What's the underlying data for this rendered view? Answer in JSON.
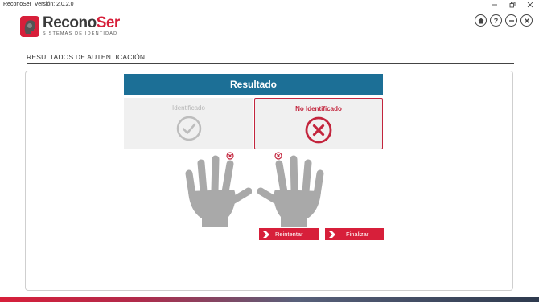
{
  "window": {
    "app_name": "ReconoSer",
    "version_label": "Versión: 2.0.2.0"
  },
  "brand": {
    "logo_main_1": "Recono",
    "logo_main_2": "Ser",
    "logo_sub": "SISTEMAS DE IDENTIDAD"
  },
  "header_icons": [
    {
      "name": "home-icon"
    },
    {
      "name": "help-icon",
      "glyph": "?"
    },
    {
      "name": "minimize-icon"
    },
    {
      "name": "close-icon"
    }
  ],
  "section": {
    "title": "RESULTADOS DE AUTENTICACIÓN"
  },
  "result": {
    "header": "Resultado",
    "identified_label": "Identificado",
    "not_identified_label": "No Identificado",
    "selected": "No Identificado"
  },
  "hands": {
    "left_marked_finger": "index",
    "right_marked_finger": "index"
  },
  "buttons": {
    "retry_label": "Reintentar",
    "finish_label": "Finalizar"
  },
  "colors": {
    "brand_red": "#d71f3a",
    "header_blue": "#1c6f96",
    "status_red": "#c3253d",
    "hand_gray": "#a9a9a9"
  }
}
